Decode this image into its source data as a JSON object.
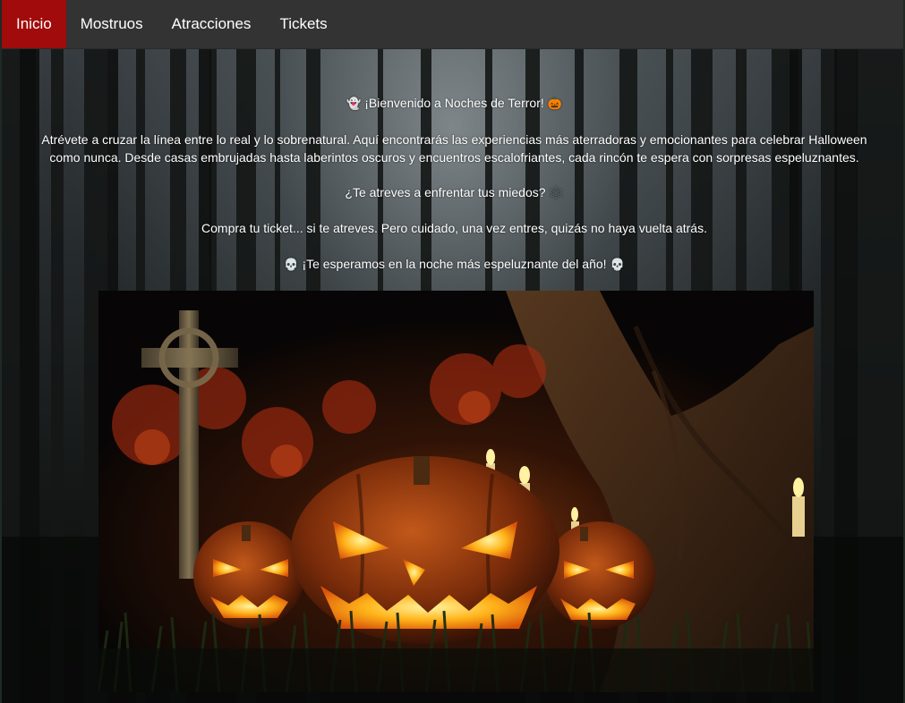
{
  "nav": {
    "items": [
      {
        "label": "Inicio",
        "active": true
      },
      {
        "label": "Mostruos",
        "active": false
      },
      {
        "label": "Atracciones",
        "active": false
      },
      {
        "label": "Tickets",
        "active": false
      }
    ]
  },
  "main": {
    "welcome": {
      "prefix_icon": "ghost-emoji",
      "text": "¡Bienvenido a Noches de Terror!",
      "suffix_icon": "pumpkin-emoji"
    },
    "intro": "Atrévete a cruzar la línea entre lo real y lo sobrenatural. Aquí encontrarás las experiencias más aterradoras y emocionantes para celebrar Halloween como nunca. Desde casas embrujadas hasta laberintos oscuros y encuentros escalofriantes, cada rincón te espera con sorpresas espeluznantes.",
    "dare": {
      "text": "¿Te atreves a enfrentar tus miedos?",
      "suffix_icon": "spider-web-emoji"
    },
    "ticket": "Compra tu ticket... si te atreves. Pero cuidado, una vez entres, quizás no haya vuelta atrás.",
    "expect": {
      "prefix_icon": "skull-emoji",
      "text": "¡Te esperamos en la noche más espeluznante del año!",
      "suffix_icon": "skull-emoji"
    },
    "hero_image": "halloween-pumpkins-graveyard-image"
  },
  "colors": {
    "navbar_bg": "#333333",
    "nav_active_bg": "#a10b0b",
    "text": "#ffffff"
  }
}
